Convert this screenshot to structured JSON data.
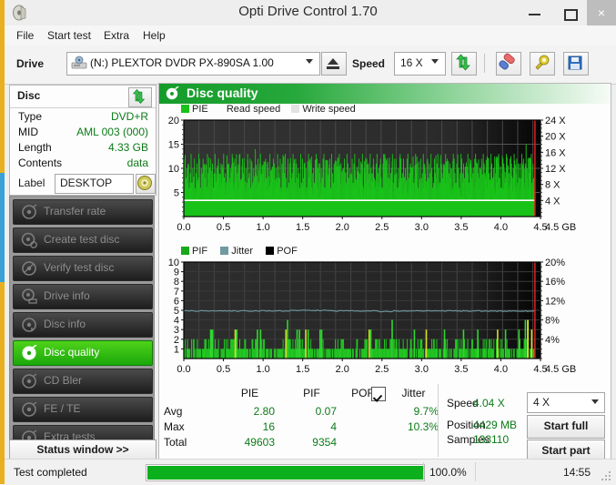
{
  "window": {
    "title": "Opti Drive Control 1.70",
    "icon": "disc-app-icon",
    "minimize": "–",
    "maximize": "□",
    "close": "×"
  },
  "menu": [
    {
      "label": "File"
    },
    {
      "label": "Start test"
    },
    {
      "label": "Extra"
    },
    {
      "label": "Help"
    }
  ],
  "toolbar": {
    "drive_label": "Drive",
    "drive_value": "(N:)   PLEXTOR DVDR   PX-890SA 1.00",
    "drive_icon": "drive-icon",
    "eject_icon": "eject-icon",
    "speed_label": "Speed",
    "speed_value": "16 X",
    "refresh_icon": "refresh-arrows-icon",
    "erase_icon": "eraser-icon",
    "tools_icon": "tools-icon",
    "save_icon": "floppy-save-icon"
  },
  "disc": {
    "title": "Disc",
    "refresh_icon": "refresh-arrows-icon",
    "rows": [
      {
        "key": "Type",
        "value": "DVD+R"
      },
      {
        "key": "MID",
        "value": "AML 003 (000)"
      },
      {
        "key": "Length",
        "value": "4.33 GB"
      },
      {
        "key": "Contents",
        "value": "data"
      }
    ],
    "label_key": "Label",
    "label_value": "DESKTOP",
    "label_icon": "disc-icon"
  },
  "nav": {
    "items": [
      {
        "label": "Transfer rate",
        "icon": "disc-transfer-icon",
        "active": false
      },
      {
        "label": "Create test disc",
        "icon": "disc-create-icon",
        "active": false
      },
      {
        "label": "Verify test disc",
        "icon": "disc-verify-icon",
        "active": false
      },
      {
        "label": "Drive info",
        "icon": "drive-info-icon",
        "active": false
      },
      {
        "label": "Disc info",
        "icon": "disc-info-icon",
        "active": false
      },
      {
        "label": "Disc quality",
        "icon": "disc-quality-icon",
        "active": true
      },
      {
        "label": "CD Bler",
        "icon": "disc-bler-icon",
        "active": false
      },
      {
        "label": "FE / TE",
        "icon": "disc-fete-icon",
        "active": false
      },
      {
        "label": "Extra tests",
        "icon": "disc-extra-icon",
        "active": false
      }
    ],
    "status_window": "Status window >>"
  },
  "main": {
    "title": "Disc quality",
    "icon": "disc-quality-icon"
  },
  "chart_data": [
    {
      "type": "bar",
      "name": "pie-chart",
      "title": "",
      "legend": [
        {
          "label": "PIE",
          "color": "#19c219"
        },
        {
          "label": "Read speed",
          "color": "#ffffff"
        },
        {
          "label": "Write speed",
          "color": "#e2e2e2"
        }
      ],
      "legend_position": "top-left",
      "xlabel": "4.5 GB",
      "ylabel": "",
      "xlim": [
        0,
        4.5
      ],
      "ylim": [
        0,
        20
      ],
      "y2lim": [
        0,
        24
      ],
      "yticks": [
        0,
        5,
        10,
        15,
        20
      ],
      "ytick_labels": [
        "",
        "5",
        "10",
        "15",
        "20"
      ],
      "y2ticks": [
        4,
        8,
        12,
        16,
        20,
        24
      ],
      "y2tick_labels": [
        "4 X",
        "8 X",
        "12 X",
        "16 X",
        "20 X",
        "24 X"
      ],
      "xticks": [
        0.0,
        0.5,
        1.0,
        1.5,
        2.0,
        2.5,
        3.0,
        3.5,
        4.0,
        4.5
      ],
      "xtick_labels": [
        "0.0",
        "0.5",
        "1.0",
        "1.5",
        "2.0",
        "2.5",
        "3.0",
        "3.5",
        "4.0",
        "4.5"
      ],
      "grid": true,
      "series": [
        {
          "name": "PIE",
          "color": "#19c219",
          "avg": 2.8,
          "max": 16,
          "total": 49603,
          "values": [
            9,
            12,
            8,
            10,
            7,
            11,
            6,
            9,
            13,
            7,
            10,
            8,
            12,
            6,
            9,
            11,
            7,
            13,
            8,
            6,
            10,
            9,
            12,
            7,
            11,
            8,
            6,
            13,
            9,
            10,
            7,
            12,
            8,
            11,
            6,
            9,
            13,
            7,
            10,
            8,
            12,
            9,
            6,
            11,
            7,
            10,
            13,
            8,
            9,
            6,
            12,
            7,
            11,
            8,
            10,
            9,
            13,
            6,
            7,
            12,
            8,
            11,
            9,
            10,
            6,
            13,
            7,
            8,
            12,
            9,
            11,
            6,
            10,
            7,
            13,
            8,
            9,
            12,
            6,
            11,
            7,
            10,
            8,
            14,
            9,
            6,
            12,
            7,
            11,
            13,
            8,
            10,
            6,
            9,
            7,
            12,
            8,
            11,
            10,
            6,
            13,
            7,
            9,
            8,
            12,
            11,
            6,
            10,
            7,
            13,
            9,
            8,
            12,
            6,
            11,
            7,
            10,
            9,
            13,
            8,
            6,
            12,
            7,
            11,
            10,
            8,
            9,
            13,
            6,
            7,
            12,
            11,
            8,
            10,
            9,
            6,
            13,
            7,
            12,
            8,
            11,
            9,
            10,
            6,
            7,
            13,
            8,
            12,
            11,
            6,
            9,
            10,
            7,
            8,
            13,
            12,
            6,
            11,
            9,
            7,
            10,
            8,
            12,
            13,
            6,
            9,
            11,
            7,
            8,
            10,
            12,
            6,
            13,
            9,
            7,
            11,
            8,
            10,
            6,
            12,
            9,
            13,
            7,
            11,
            8,
            6,
            10,
            12,
            9,
            7,
            13,
            11,
            8,
            10,
            6,
            9,
            12,
            7,
            11,
            13,
            8,
            6,
            10,
            9,
            12,
            7,
            8,
            11,
            13,
            6,
            10,
            9,
            7,
            12,
            8,
            11,
            6,
            13,
            10,
            9,
            7,
            12,
            8,
            6,
            11,
            13,
            9,
            10,
            7,
            12,
            8,
            6,
            11,
            9,
            13,
            10,
            7,
            12,
            8,
            11,
            6,
            9,
            10,
            13,
            7,
            12,
            8,
            11,
            9,
            6,
            10,
            7,
            13,
            12,
            8,
            9,
            11,
            6,
            10,
            7,
            12,
            13,
            8,
            9,
            11,
            6,
            10,
            12,
            7,
            8,
            13,
            9,
            11,
            6,
            10,
            7,
            12,
            8,
            9,
            13,
            11,
            10,
            6,
            7,
            12,
            8,
            11,
            9,
            13,
            10,
            6,
            7,
            12,
            9,
            8,
            11,
            13,
            10,
            6,
            12,
            7,
            9,
            8,
            11,
            10,
            13,
            6,
            12,
            7,
            9,
            11,
            8,
            10,
            6,
            13,
            12,
            9,
            7,
            11,
            8,
            10,
            6,
            9,
            13,
            12,
            7,
            11,
            8,
            10,
            9,
            6,
            13,
            7,
            12,
            11,
            8,
            10,
            9,
            6,
            12,
            13,
            7,
            11,
            9,
            8,
            10,
            6,
            12,
            7,
            13,
            11,
            9,
            8,
            10,
            6,
            12,
            9,
            7,
            13,
            11,
            8,
            10,
            6,
            9,
            12,
            7,
            11,
            13,
            8,
            10,
            6,
            9,
            12,
            11,
            7,
            8,
            13,
            10,
            6,
            9,
            12,
            7,
            11,
            8,
            10,
            13,
            6,
            9,
            12,
            7,
            11,
            8,
            10,
            6,
            13,
            9,
            12,
            7,
            11,
            15,
            10,
            8,
            6,
            9,
            12,
            13,
            7,
            11,
            8,
            10
          ]
        },
        {
          "name": "Read speed",
          "color": "#ffffff",
          "final_value": 4.04,
          "values": [
            3.9,
            4.0,
            4.0,
            4.0,
            4.0,
            4.0,
            4.0,
            4.0,
            4.0,
            4.0,
            4.0,
            4.0,
            4.0,
            4.0,
            4.0,
            4.0,
            4.0,
            4.0,
            4.0,
            4.0
          ]
        }
      ],
      "cursor_x": 4.43,
      "cursor_color": "#e02020"
    },
    {
      "type": "bar",
      "name": "pif-chart",
      "title": "",
      "legend": [
        {
          "label": "PIF",
          "color": "#19a819"
        },
        {
          "label": "Jitter",
          "color": "#6e9aa0"
        },
        {
          "label": "POF",
          "color": "#000000"
        }
      ],
      "legend_position": "top-left",
      "xlabel": "4.5 GB",
      "ylabel": "",
      "xlim": [
        0,
        4.5
      ],
      "ylim": [
        0,
        10
      ],
      "y2lim": [
        0,
        20
      ],
      "yticks": [
        1,
        2,
        3,
        4,
        5,
        6,
        7,
        8,
        9,
        10
      ],
      "ytick_labels": [
        "1",
        "2",
        "3",
        "4",
        "5",
        "6",
        "7",
        "8",
        "9",
        "10"
      ],
      "y2ticks": [
        4,
        8,
        12,
        16,
        20
      ],
      "y2tick_labels": [
        "4%",
        "8%",
        "12%",
        "16%",
        "20%"
      ],
      "xticks": [
        0.0,
        0.5,
        1.0,
        1.5,
        2.0,
        2.5,
        3.0,
        3.5,
        4.0,
        4.5
      ],
      "xtick_labels": [
        "0.0",
        "0.5",
        "1.0",
        "1.5",
        "2.0",
        "2.5",
        "3.0",
        "3.5",
        "4.0",
        "4.5"
      ],
      "grid": true,
      "series": [
        {
          "name": "PIF",
          "color": "#19c219",
          "avg": 0.07,
          "max": 4,
          "total": 9354,
          "values": [
            1,
            0,
            1,
            2,
            0,
            1,
            1,
            0,
            2,
            1,
            0,
            1,
            0,
            2,
            1,
            1,
            0,
            1,
            2,
            0,
            1,
            0,
            1,
            1,
            2,
            0,
            1,
            0,
            1,
            2,
            1,
            0,
            1,
            1,
            0,
            2,
            1,
            0,
            1,
            3,
            1,
            0,
            2,
            1,
            1,
            0,
            1,
            2,
            0,
            1,
            1,
            0,
            2,
            1,
            0,
            1,
            1,
            2,
            0,
            1,
            0,
            1,
            1,
            0,
            2,
            1,
            0,
            1,
            2,
            1,
            0,
            1,
            1,
            0,
            2,
            1,
            0,
            1,
            2,
            1,
            0,
            2,
            1,
            0,
            1,
            1,
            2,
            0,
            1,
            0,
            1,
            2,
            1,
            0,
            1,
            1,
            0,
            2,
            1,
            0,
            1,
            0,
            1,
            2,
            1,
            0,
            1,
            1,
            2,
            0,
            1,
            0,
            2,
            1,
            1,
            0,
            1,
            2,
            0,
            1,
            0,
            1,
            1,
            2,
            0,
            1,
            1,
            0,
            2,
            1,
            0,
            1,
            2,
            1,
            0,
            1,
            1,
            2,
            0,
            1,
            0,
            2,
            1,
            1,
            0,
            2,
            1,
            0,
            1,
            1,
            2,
            0,
            1,
            2,
            1,
            0,
            2,
            1,
            1,
            0,
            2,
            1,
            0,
            3,
            1,
            2,
            0,
            1,
            1,
            2,
            0,
            1,
            2,
            1,
            0,
            1,
            2,
            1,
            0,
            2,
            1,
            1,
            0,
            1,
            2,
            0,
            1,
            1,
            2,
            0,
            3,
            1,
            2,
            0,
            1,
            2,
            1,
            0,
            1,
            2,
            1,
            3,
            0,
            1,
            2,
            1,
            0,
            2,
            1,
            0,
            1,
            2,
            1,
            0,
            1,
            2,
            0,
            1,
            1,
            2,
            0,
            1,
            0,
            2,
            1,
            1,
            0,
            1,
            2,
            0,
            1,
            1,
            0,
            2,
            1,
            0,
            1,
            1,
            2,
            0,
            1,
            0,
            1,
            2,
            1,
            0,
            1,
            1,
            2,
            0,
            1,
            2,
            1,
            0,
            1,
            1,
            2,
            0,
            1,
            0,
            1,
            2,
            1,
            0,
            1,
            2,
            1,
            0,
            1,
            2,
            0,
            1,
            1,
            2,
            0,
            1,
            1,
            2,
            0,
            1,
            0,
            2,
            1,
            1,
            2,
            0,
            1,
            1,
            0,
            2,
            1,
            0,
            1,
            2,
            1,
            1,
            0,
            2,
            1,
            0,
            1,
            2,
            1,
            0,
            1,
            2,
            1,
            0,
            1,
            2,
            0,
            1,
            2,
            1,
            0,
            1,
            2,
            1,
            0,
            1,
            2,
            0,
            1,
            1,
            2,
            0,
            1,
            2,
            1,
            0,
            1,
            2,
            1,
            0,
            2,
            1,
            0,
            1,
            2,
            1,
            0,
            1,
            2,
            1,
            0,
            2,
            1,
            3,
            0,
            1,
            2,
            1,
            0,
            2,
            1,
            4,
            0,
            1,
            2,
            1,
            0,
            1,
            2,
            1,
            0,
            1,
            2,
            1,
            0,
            1,
            2
          ]
        },
        {
          "name": "Jitter",
          "color": "#6e9aa0",
          "avg": 9.7,
          "max": 10.3,
          "values": [
            5.0,
            4.95,
            5.0,
            4.9,
            4.95,
            4.9,
            4.95,
            4.9,
            4.9,
            4.95,
            4.9,
            4.85,
            4.9,
            4.9,
            4.85,
            4.9,
            5.0,
            5.1,
            5.0,
            4.95,
            4.9,
            4.85,
            4.9,
            4.85,
            4.9,
            4.85,
            4.9,
            4.85,
            4.9,
            4.95
          ]
        }
      ],
      "cursor_x": 4.43,
      "cursor_color": "#e02020"
    }
  ],
  "stats": {
    "columns": [
      "PIE",
      "PIF",
      "POF",
      "Jitter"
    ],
    "jitter_checkbox": true,
    "rows": [
      {
        "label": "Avg",
        "pie": "2.80",
        "pif": "0.07",
        "pof": "",
        "jitter": "9.7%"
      },
      {
        "label": "Max",
        "pie": "16",
        "pif": "4",
        "pof": "",
        "jitter": "10.3%"
      },
      {
        "label": "Total",
        "pie": "49603",
        "pif": "9354",
        "pof": "",
        "jitter": ""
      }
    ]
  },
  "results": {
    "speed_label": "Speed",
    "speed_value": "4.04 X",
    "position_label": "Position",
    "position_value": "4429 MB",
    "samples_label": "Samples",
    "samples_value": "133110",
    "speed_select": "4 X",
    "start_full": "Start full",
    "start_part": "Start part"
  },
  "statusbar": {
    "message": "Test completed",
    "progress_pct": "100.0%",
    "progress_value": 100,
    "time": "14:55"
  },
  "colors": {
    "accent_green": "#19c219",
    "value_green": "#0c7a18",
    "cursor_red": "#e02020",
    "jitter": "#6e9aa0"
  }
}
